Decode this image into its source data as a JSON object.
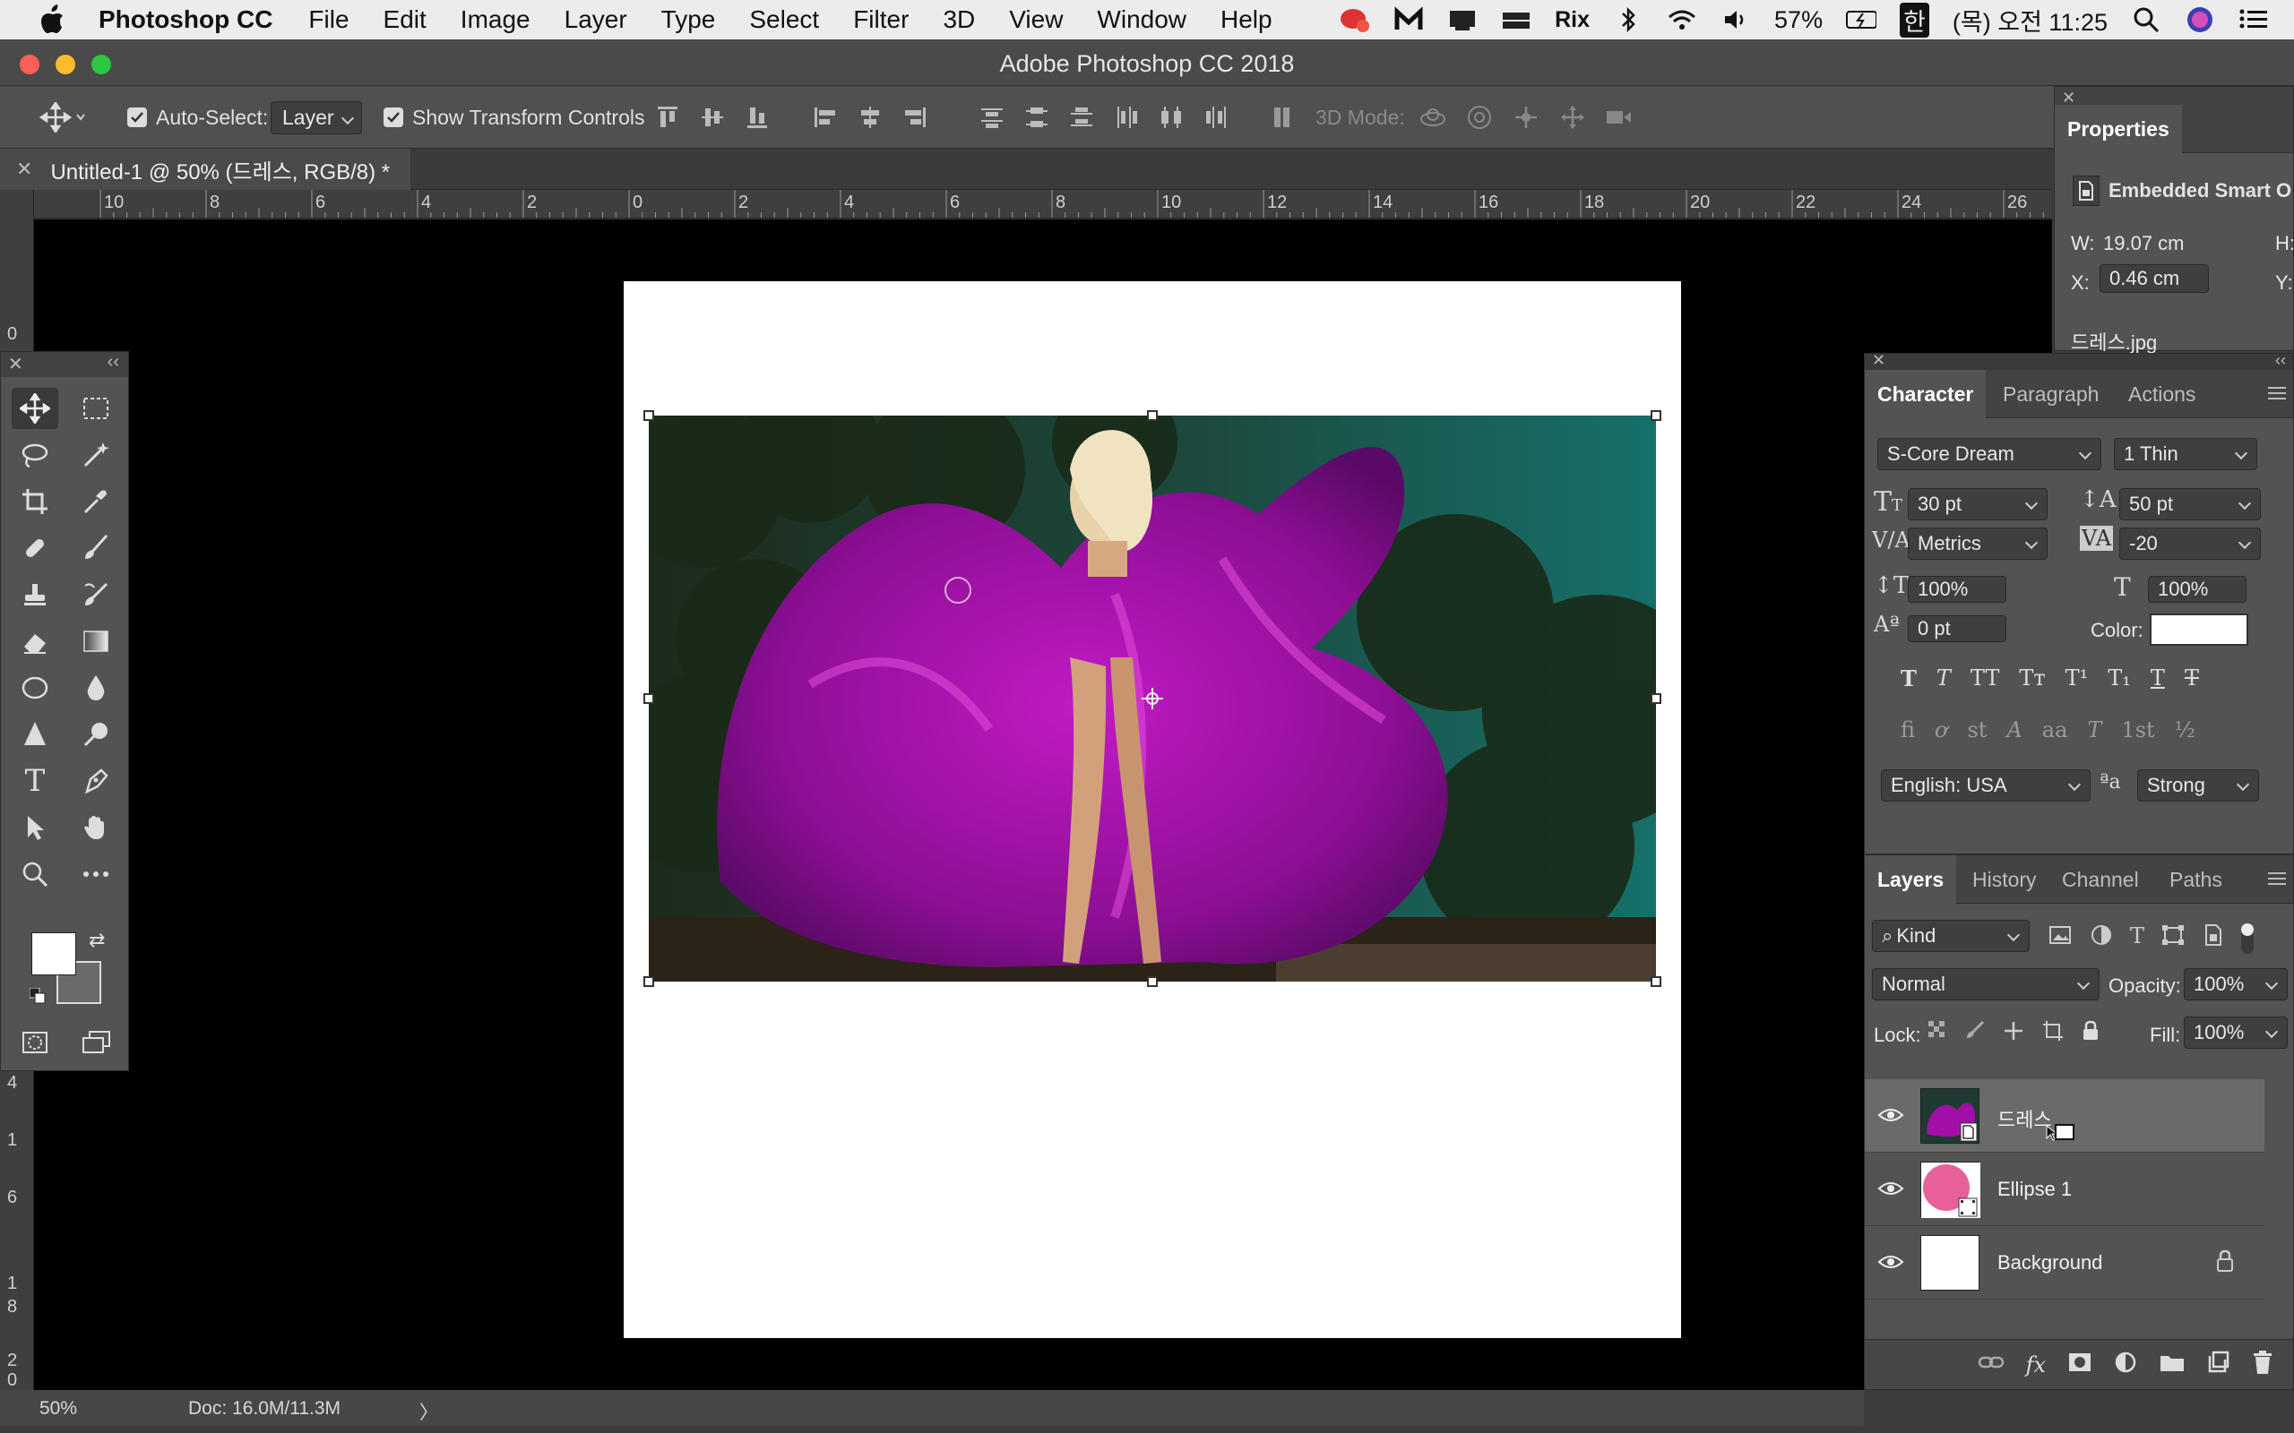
{
  "menubar": {
    "app_name": "Photoshop CC",
    "items": [
      "File",
      "Edit",
      "Image",
      "Layer",
      "Type",
      "Select",
      "Filter",
      "3D",
      "View",
      "Window",
      "Help"
    ],
    "status": {
      "rix": "Rix",
      "battery": "57%",
      "ime": "한",
      "clock": "(목) 오전 11:25"
    }
  },
  "window": {
    "title": "Adobe Photoshop CC 2018"
  },
  "options_bar": {
    "auto_select_label": "Auto-Select:",
    "auto_select_value": "Layer",
    "show_transform_label": "Show Transform Controls",
    "mode_3d_label": "3D Mode:"
  },
  "document_tab": {
    "title": "Untitled-1 @ 50% (드레스, RGB/8) *"
  },
  "rulers": {
    "horizontal": [
      "10",
      "8",
      "6",
      "4",
      "2",
      "0",
      "2",
      "4",
      "6",
      "8",
      "10",
      "12",
      "14",
      "16",
      "18",
      "20",
      "22",
      "24",
      "26"
    ],
    "vertical": [
      "0",
      "4",
      "6",
      "8",
      "0"
    ],
    "vertical_major": [
      "1",
      "1",
      "2"
    ]
  },
  "status_bar": {
    "zoom": "50%",
    "doc_size": "Doc: 16.0M/11.3M",
    "arrow": "〉"
  },
  "properties_panel": {
    "tab": "Properties",
    "type_label": "Embedded Smart O",
    "w_label": "W:",
    "w_value": "19.07 cm",
    "h_label": "H:",
    "x_label": "X:",
    "x_value": "0.46 cm",
    "y_label": "Y:",
    "file_name": "드레스.jpg"
  },
  "character_panel": {
    "tabs": [
      "Character",
      "Paragraph",
      "Actions"
    ],
    "font_family": "S-Core Dream",
    "font_style": "1 Thin",
    "font_size": "30 pt",
    "leading": "50 pt",
    "kerning": "Metrics",
    "tracking": "-20",
    "vertical_scale": "100%",
    "horizontal_scale": "100%",
    "baseline_shift": "0 pt",
    "color_label": "Color:",
    "color_value": "#ffffff",
    "language": "English: USA",
    "aa_label": "ªa",
    "antialias": "Strong"
  },
  "layers_panel": {
    "tabs": [
      "Layers",
      "History",
      "Channel",
      "Paths"
    ],
    "filter_kind": "Kind",
    "blend_mode": "Normal",
    "opacity_label": "Opacity:",
    "opacity_value": "100%",
    "lock_label": "Lock:",
    "fill_label": "Fill:",
    "fill_value": "100%",
    "layers": [
      {
        "name": "드레스",
        "selected": true
      },
      {
        "name": "Ellipse 1",
        "selected": false
      },
      {
        "name": "Background",
        "selected": false,
        "locked": true
      }
    ]
  },
  "colors": {
    "foreground": "#ffffff",
    "background": "#6b6b6b",
    "dress": "#a10fa8",
    "ellipse": "#e8609a"
  }
}
